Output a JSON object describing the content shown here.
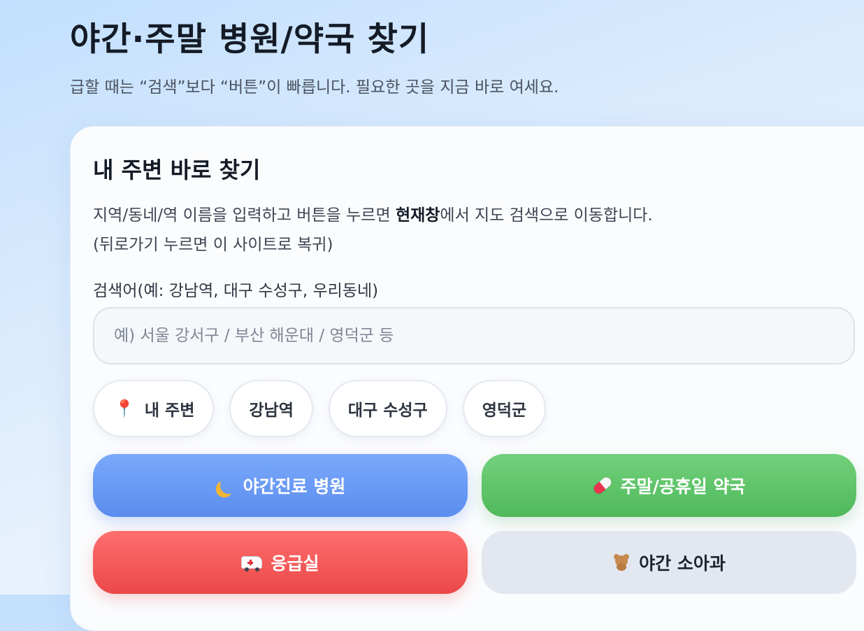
{
  "header": {
    "title": "야간·주말 병원/약국 찾기",
    "subtitle": "급할 때는 “검색”보다 “버튼”이 빠릅니다. 필요한 곳을 지금 바로 여세요."
  },
  "card": {
    "title": "내 주변 바로 찾기",
    "description_part1": "지역/동네/역 이름을 입력하고 버튼을 누르면 ",
    "description_emphasis": "현재창",
    "description_part2": "에서 지도 검색으로 이동합니다.",
    "description_line2": "(뒤로가기 누르면 이 사이트로 복귀)"
  },
  "search": {
    "label": "검색어(예: 강남역, 대구 수성구, 우리동네)",
    "value": "",
    "placeholder": "예) 서울 강서구 / 부산 해운대 / 영덕군 등"
  },
  "chips": [
    {
      "label": "내 주변",
      "icon": "pin-icon"
    },
    {
      "label": "강남역"
    },
    {
      "label": "대구 수성구"
    },
    {
      "label": "영덕군"
    }
  ],
  "actions": {
    "night_hospital": {
      "label": "야간진료 병원",
      "icon": "moon-icon",
      "color": "#5b8def"
    },
    "weekend_pharmacy": {
      "label": "주말/공휴일 약국",
      "icon": "pill-icon",
      "color": "#4fb95a"
    },
    "emergency": {
      "label": "응급실",
      "icon": "ambulance-icon",
      "color": "#eb4848"
    },
    "night_pediatrics": {
      "label": "야간 소아과",
      "icon": "bear-icon",
      "color": "#e3e8f0"
    }
  }
}
